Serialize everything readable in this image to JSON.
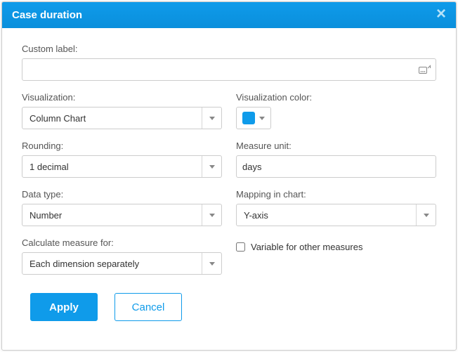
{
  "header": {
    "title": "Case duration"
  },
  "fields": {
    "customLabel": {
      "label": "Custom label:",
      "value": ""
    },
    "visualization": {
      "label": "Visualization:",
      "value": "Column Chart"
    },
    "visualizationColor": {
      "label": "Visualization color:",
      "value": "#0f9bea"
    },
    "rounding": {
      "label": "Rounding:",
      "value": "1 decimal"
    },
    "measureUnit": {
      "label": "Measure unit:",
      "value": "days"
    },
    "dataType": {
      "label": "Data type:",
      "value": "Number"
    },
    "mapping": {
      "label": "Mapping in chart:",
      "value": "Y-axis"
    },
    "calculateFor": {
      "label": "Calculate measure for:",
      "value": "Each dimension separately"
    },
    "variableForOthers": {
      "label": "Variable for other measures",
      "checked": false
    }
  },
  "footer": {
    "apply": "Apply",
    "cancel": "Cancel"
  }
}
